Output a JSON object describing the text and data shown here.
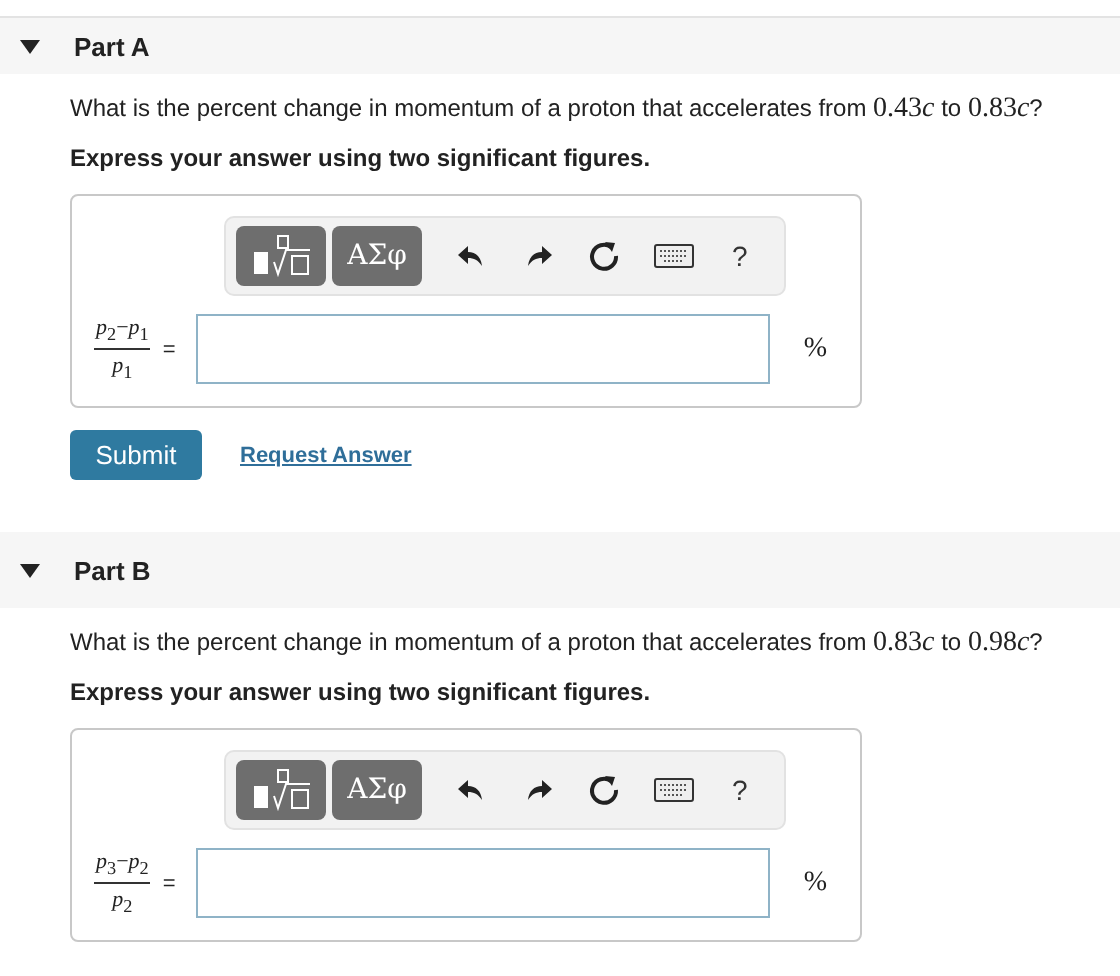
{
  "parts": [
    {
      "title": "Part A",
      "expanded": true,
      "question": [
        {
          "kind": "text",
          "text": "What is the percent change in momentum of a proton that accelerates from "
        },
        {
          "kind": "number",
          "text": "0.43"
        },
        {
          "kind": "variable",
          "text": "c"
        },
        {
          "kind": "text",
          "text": " to "
        },
        {
          "kind": "number",
          "text": "0.83"
        },
        {
          "kind": "variable",
          "text": "c"
        },
        {
          "kind": "text",
          "text": "?"
        }
      ],
      "instruction": "Express your answer using two significant figures.",
      "toolbar": {
        "symbols_label": "ΑΣφ",
        "help_label": "?"
      },
      "answer": {
        "numerator": "*p*$_{2}$−*p*$_{1}$",
        "denominator": "*p*$_{1}$",
        "equals": "=",
        "unit": "%"
      },
      "actions": {
        "submit": "Submit",
        "request": "Request Answer"
      }
    },
    {
      "title": "Part B",
      "expanded": true,
      "question": [
        {
          "kind": "text",
          "text": "What is the percent change in momentum of a proton that accelerates from "
        },
        {
          "kind": "number",
          "text": "0.83"
        },
        {
          "kind": "variable",
          "text": "c"
        },
        {
          "kind": "text",
          "text": " to "
        },
        {
          "kind": "number",
          "text": "0.98"
        },
        {
          "kind": "variable",
          "text": "c"
        },
        {
          "kind": "text",
          "text": "?"
        }
      ],
      "instruction": "Express your answer using two significant figures.",
      "toolbar": {
        "symbols_label": "ΑΣφ",
        "help_label": "?"
      },
      "answer": {
        "numerator": "*p*$_{3}$−*p*$_{2}$",
        "denominator": "*p*$_{2}$",
        "equals": "=",
        "unit": "%"
      }
    }
  ]
}
